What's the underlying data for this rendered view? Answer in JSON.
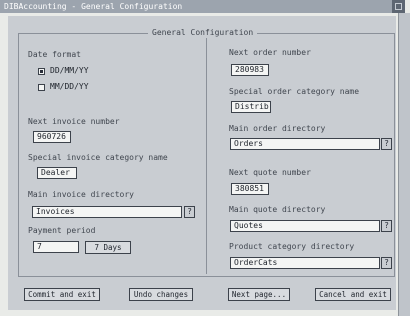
{
  "window": {
    "title": "DIBAccounting - General Configuration"
  },
  "group": {
    "title": "General Configuration"
  },
  "date_format": {
    "label": "Date format",
    "options": [
      "DD/MM/YY",
      "MM/DD/YY"
    ],
    "selected_index": 0
  },
  "next_invoice_number": {
    "label": "Next invoice number",
    "value": "960726"
  },
  "special_invoice_category": {
    "label": "Special invoice category name",
    "value": "Dealer"
  },
  "main_invoice_directory": {
    "label": "Main invoice directory",
    "value": "Invoices",
    "popup": "?"
  },
  "payment_period": {
    "label": "Payment period",
    "value": "7",
    "unit": "Days"
  },
  "next_order_number": {
    "label": "Next order number",
    "value": "280983"
  },
  "special_order_category": {
    "label": "Special order category name",
    "value": "Distrib"
  },
  "main_order_directory": {
    "label": "Main order directory",
    "value": "Orders",
    "popup": "?"
  },
  "next_quote_number": {
    "label": "Next quote number",
    "value": "380851"
  },
  "main_quote_directory": {
    "label": "Main quote directory",
    "value": "Quotes",
    "popup": "?"
  },
  "product_category_directory": {
    "label": "Product category directory",
    "value": "OrderCats",
    "popup": "?"
  },
  "buttons": {
    "commit": "Commit and exit",
    "undo": "Undo changes",
    "next": "Next page...",
    "cancel": "Cancel and exit"
  }
}
